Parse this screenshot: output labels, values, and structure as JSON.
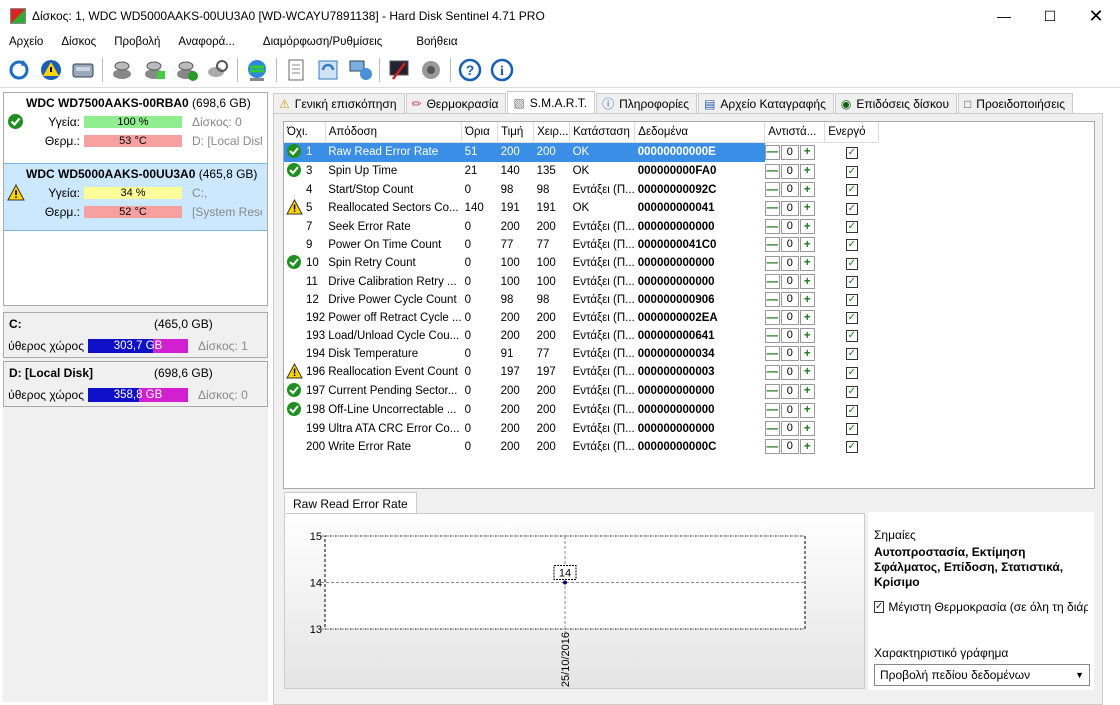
{
  "window": {
    "title": "Δίσκος: 1, WDC WD5000AAKS-00UU3A0 [WD-WCAYU7891138]  -  Hard Disk Sentinel 4.71 PRO"
  },
  "menu": [
    "Αρχείο",
    "Δίσκος",
    "Προβολή",
    "Αναφορά...",
    "Διαμόρφωση/Ρυθμίσεις",
    "Βοήθεια"
  ],
  "toolbar_icons": [
    "refresh-icon",
    "warning-icon",
    "disk-icon",
    "disk-scan-icon",
    "disk-test-icon",
    "disk-ok-icon",
    "disk-search-icon",
    "globe-icon",
    "report-icon",
    "update-icon",
    "network-icon",
    "settings-icon",
    "sound-icon",
    "help-icon",
    "info-icon"
  ],
  "disks": [
    {
      "name": "WDC WD7500AAKS-00RBA0",
      "size": "(698,6 GB)",
      "health_label": "Υγεία:",
      "health": "100 %",
      "health_pct": 100,
      "health_sub": "Δίσκος: 0",
      "temp_label": "Θερμ.:",
      "temp": "53 °C",
      "temp_sub": "D: [Local Disk]"
    },
    {
      "name": "WDC WD5000AAKS-00UU3A0",
      "size": "(465,8 GB)",
      "health_label": "Υγεία:",
      "health": "34 %",
      "health_pct": 34,
      "health_sub": "C:,",
      "temp_label": "Θερμ.:",
      "temp": "52 °C",
      "temp_sub": "[System Reserved]"
    }
  ],
  "volumes": [
    {
      "name": "C:",
      "size": "(465,0 GB)",
      "free_label": "ύθερος χώρος",
      "free": "303,7 GB",
      "free_pct": 65,
      "disk": "Δίσκος: 1"
    },
    {
      "name": "D: [Local Disk]",
      "size": "(698,6 GB)",
      "free_label": "ύθερος χώρος",
      "free": "358,8 GB",
      "free_pct": 51,
      "disk": "Δίσκος: 0"
    }
  ],
  "tabs": [
    "Γενική επισκόπηση",
    "Θερμοκρασία",
    "S.M.A.R.T.",
    "Πληροφορίες",
    "Αρχείο Καταγραφής",
    "Επιδόσεις δίσκου",
    "Προειδοποιήσεις"
  ],
  "columns": [
    "Όχι.",
    "Απόδοση",
    "Όρια",
    "Τιμή",
    "Χειρ...",
    "Κατάσταση",
    "Δεδομένα",
    "Αντιστά...",
    "Ενεργό"
  ],
  "rows": [
    {
      "icon": "ok",
      "id": "1",
      "name": "Raw Read Error Rate",
      "thr": "51",
      "val": "200",
      "worst": "200",
      "status": "OK",
      "data": "00000000000E",
      "offset": "0"
    },
    {
      "icon": "ok",
      "id": "3",
      "name": "Spin Up Time",
      "thr": "21",
      "val": "140",
      "worst": "135",
      "status": "OK",
      "data": "000000000FA0",
      "offset": "0"
    },
    {
      "icon": "",
      "id": "4",
      "name": "Start/Stop Count",
      "thr": "0",
      "val": "98",
      "worst": "98",
      "status": "Εντάξει (Π...",
      "data": "00000000092C",
      "offset": "0"
    },
    {
      "icon": "warn",
      "id": "5",
      "name": "Reallocated Sectors Co...",
      "thr": "140",
      "val": "191",
      "worst": "191",
      "status": "OK",
      "data": "000000000041",
      "offset": "0"
    },
    {
      "icon": "",
      "id": "7",
      "name": "Seek Error Rate",
      "thr": "0",
      "val": "200",
      "worst": "200",
      "status": "Εντάξει (Π...",
      "data": "000000000000",
      "offset": "0"
    },
    {
      "icon": "",
      "id": "9",
      "name": "Power On Time Count",
      "thr": "0",
      "val": "77",
      "worst": "77",
      "status": "Εντάξει (Π...",
      "data": "0000000041C0",
      "offset": "0"
    },
    {
      "icon": "ok",
      "id": "10",
      "name": "Spin Retry Count",
      "thr": "0",
      "val": "100",
      "worst": "100",
      "status": "Εντάξει (Π...",
      "data": "000000000000",
      "offset": "0"
    },
    {
      "icon": "",
      "id": "11",
      "name": "Drive Calibration Retry ...",
      "thr": "0",
      "val": "100",
      "worst": "100",
      "status": "Εντάξει (Π...",
      "data": "000000000000",
      "offset": "0"
    },
    {
      "icon": "",
      "id": "12",
      "name": "Drive Power Cycle Count",
      "thr": "0",
      "val": "98",
      "worst": "98",
      "status": "Εντάξει (Π...",
      "data": "000000000906",
      "offset": "0"
    },
    {
      "icon": "",
      "id": "192",
      "name": "Power off Retract Cycle ...",
      "thr": "0",
      "val": "200",
      "worst": "200",
      "status": "Εντάξει (Π...",
      "data": "0000000002EA",
      "offset": "0"
    },
    {
      "icon": "",
      "id": "193",
      "name": "Load/Unload Cycle Cou...",
      "thr": "0",
      "val": "200",
      "worst": "200",
      "status": "Εντάξει (Π...",
      "data": "000000000641",
      "offset": "0"
    },
    {
      "icon": "",
      "id": "194",
      "name": "Disk Temperature",
      "thr": "0",
      "val": "91",
      "worst": "77",
      "status": "Εντάξει (Π...",
      "data": "000000000034",
      "offset": "0"
    },
    {
      "icon": "warn",
      "id": "196",
      "name": "Reallocation Event Count",
      "thr": "0",
      "val": "197",
      "worst": "197",
      "status": "Εντάξει (Π...",
      "data": "000000000003",
      "offset": "0"
    },
    {
      "icon": "ok",
      "id": "197",
      "name": "Current Pending Sector...",
      "thr": "0",
      "val": "200",
      "worst": "200",
      "status": "Εντάξει (Π...",
      "data": "000000000000",
      "offset": "0"
    },
    {
      "icon": "ok",
      "id": "198",
      "name": "Off-Line Uncorrectable ...",
      "thr": "0",
      "val": "200",
      "worst": "200",
      "status": "Εντάξει (Π...",
      "data": "000000000000",
      "offset": "0"
    },
    {
      "icon": "",
      "id": "199",
      "name": "Ultra ATA CRC Error Co...",
      "thr": "0",
      "val": "200",
      "worst": "200",
      "status": "Εντάξει (Π...",
      "data": "000000000000",
      "offset": "0"
    },
    {
      "icon": "",
      "id": "200",
      "name": "Write Error Rate",
      "thr": "0",
      "val": "200",
      "worst": "200",
      "status": "Εντάξει (Π...",
      "data": "00000000000C",
      "offset": "0"
    }
  ],
  "chart": {
    "tab_label": "Raw Read Error Rate",
    "chart_data": {
      "type": "line",
      "x": [
        "25/10/2016"
      ],
      "series": [
        {
          "values": [
            14
          ]
        }
      ],
      "ylim": [
        13,
        15
      ],
      "yticks": [
        "15",
        "14",
        "13"
      ],
      "data_labels": [
        "14"
      ],
      "grid": true
    }
  },
  "side": {
    "flags_title": "Σημαίες",
    "flags": "Αυτοπροστασία, Εκτίμηση Σφάλματος, Επίδοση, Στατιστικά, Κρίσιμο",
    "maxtemp_label": "Μέγιστη Θερμοκρασία (σε όλη τη διάρκεια)",
    "charttype_label": "Χαρακτηριστικό γράφημα",
    "charttype_value": "Προβολή πεδίου δεδομένων"
  },
  "colors": {
    "selected": "#3a8ee6",
    "health_ok": "#90ee90",
    "health_warn": "#ffff99",
    "temp": "#f7a0a0",
    "free_bar": "#1010c8",
    "used_bar": "#d020d0",
    "ok_icon": "#2a9a2a",
    "warn_icon": "#ffd400"
  }
}
